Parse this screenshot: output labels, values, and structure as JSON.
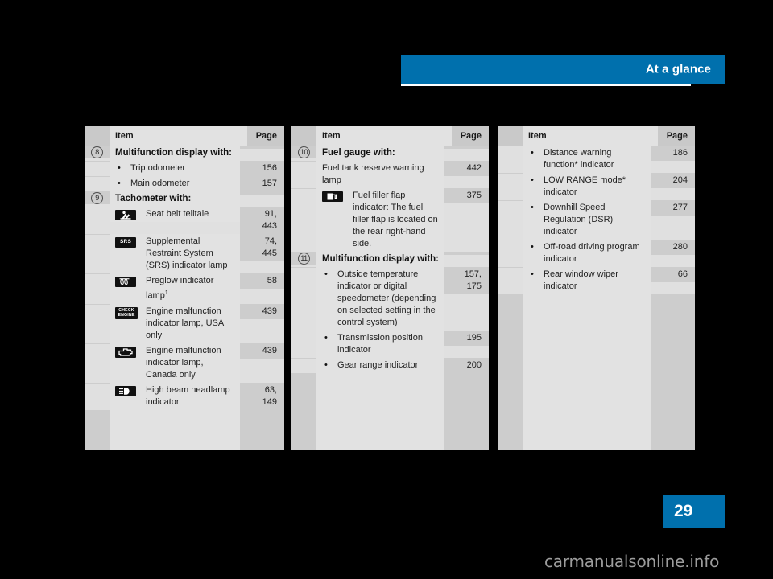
{
  "header": {
    "title": "At a glance"
  },
  "footer": {
    "page_number": "29",
    "watermark": "carmanualsonline.info"
  },
  "colors": {
    "accent_blue": "#0070ad",
    "page_background": "#000000",
    "table_item_bg": "#e2e2e2",
    "table_side_bg": "#cdcdcd",
    "header_row_bg": "#e0e0e0"
  },
  "columns": [
    {
      "id": "column-1",
      "headers": {
        "item": "Item",
        "page": "Page"
      },
      "rows": [
        {
          "num": "8",
          "kind": "heading",
          "text": "Multifunction display with:",
          "page": ""
        },
        {
          "num": "",
          "kind": "bullet",
          "text": "Trip odometer",
          "page": "156"
        },
        {
          "num": "",
          "kind": "bullet",
          "text": "Main odometer",
          "page": "157"
        },
        {
          "num": "9",
          "kind": "heading",
          "text": "Tachometer with:",
          "page": ""
        },
        {
          "num": "",
          "kind": "icon",
          "icon": "seat-belt-telltale-icon",
          "text": "Seat belt telltale",
          "page": "91,\n443"
        },
        {
          "num": "",
          "kind": "icon",
          "icon": "srs-indicator-icon",
          "text": "Supplemental Restraint System (SRS) indicator lamp",
          "page": "74,\n445"
        },
        {
          "num": "",
          "kind": "icon",
          "icon": "preglow-indicator-icon",
          "text": "Preglow indicator lamp",
          "footnote": "1",
          "page": "58"
        },
        {
          "num": "",
          "kind": "icon",
          "icon": "check-engine-icon",
          "text": "Engine malfunction indicator lamp, USA only",
          "page": "439"
        },
        {
          "num": "",
          "kind": "icon",
          "icon": "engine-malfunction-icon",
          "text": "Engine malfunction indicator lamp, Canada only",
          "page": "439"
        },
        {
          "num": "",
          "kind": "icon",
          "icon": "high-beam-headlamp-icon",
          "text": "High beam headlamp indicator",
          "page": "63,\n149"
        }
      ]
    },
    {
      "id": "column-2",
      "headers": {
        "item": "Item",
        "page": "Page"
      },
      "rows": [
        {
          "num": "10",
          "kind": "heading",
          "text": "Fuel gauge with:",
          "page": ""
        },
        {
          "num": "",
          "kind": "plain",
          "text": "Fuel tank reserve warning lamp",
          "page": "442"
        },
        {
          "num": "",
          "kind": "icon",
          "icon": "fuel-filler-flap-icon",
          "text": "Fuel filler flap indicator: The fuel filler flap is located on the rear right-hand side.",
          "page": "375"
        },
        {
          "num": "11",
          "kind": "heading",
          "text": "Multifunction display with:",
          "page": ""
        },
        {
          "num": "",
          "kind": "bullet",
          "text": "Outside temperature indicator or digital speedometer (depending on selected setting in the control system)",
          "page": "157,\n175"
        },
        {
          "num": "",
          "kind": "bullet",
          "text": "Transmission position indicator",
          "page": "195"
        },
        {
          "num": "",
          "kind": "bullet",
          "text": "Gear range indicator",
          "page": "200"
        }
      ]
    },
    {
      "id": "column-3",
      "headers": {
        "item": "Item",
        "page": "Page"
      },
      "rows": [
        {
          "num": "",
          "kind": "bullet",
          "text": "Distance warning function* indicator",
          "page": "186"
        },
        {
          "num": "",
          "kind": "bullet",
          "text": "LOW RANGE mode* indicator",
          "page": "204"
        },
        {
          "num": "",
          "kind": "bullet",
          "text": "Downhill Speed Regulation (DSR) indicator",
          "page": "277"
        },
        {
          "num": "",
          "kind": "bullet",
          "text": "Off-road driving program indicator",
          "page": "280"
        },
        {
          "num": "",
          "kind": "bullet",
          "text": "Rear window wiper indicator",
          "page": "66"
        }
      ]
    }
  ]
}
